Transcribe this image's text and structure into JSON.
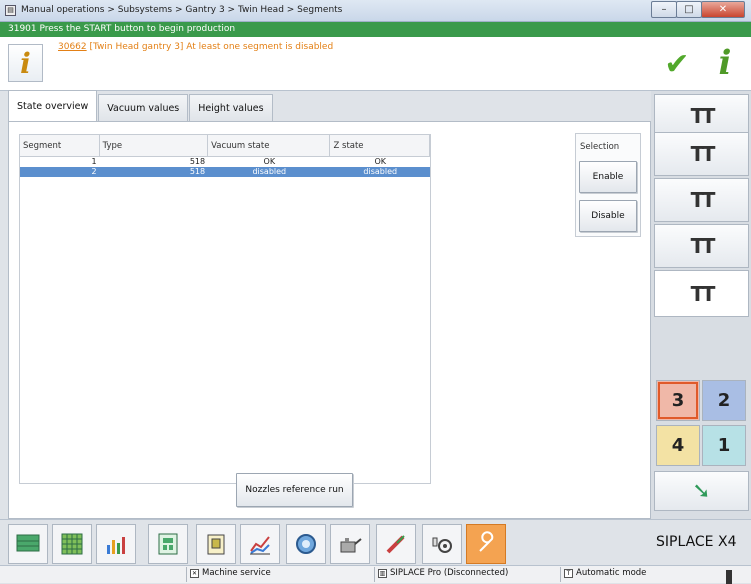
{
  "window": {
    "breadcrumb": "Manual operations > Subsystems > Gantry 3 > Twin Head > Segments",
    "minimize": "–",
    "maximize": "□",
    "close": "✕"
  },
  "status_banner": "31901 Press the START button to begin production",
  "message": {
    "code": "30662",
    "text": " [Twin Head gantry 3] At least one segment is disabled"
  },
  "icons": {
    "info": "i",
    "check": "✔",
    "nozzle_pair": "TT",
    "arrow": "➘"
  },
  "tabs": [
    {
      "label": "State overview",
      "active": true
    },
    {
      "label": "Vacuum values",
      "active": false
    },
    {
      "label": "Height values",
      "active": false
    }
  ],
  "table": {
    "columns": [
      "Segment",
      "Type",
      "Vacuum state",
      "Z state"
    ],
    "rows": [
      {
        "segment": "1",
        "type": "518",
        "vacuum": "OK",
        "z": "OK",
        "selected": false
      },
      {
        "segment": "2",
        "type": "518",
        "vacuum": "disabled",
        "z": "disabled",
        "selected": true
      }
    ]
  },
  "selection": {
    "label": "Selection",
    "enable": "Enable",
    "disable": "Disable"
  },
  "nozzle_button": "Nozzles reference run",
  "gantries": [
    "3",
    "2",
    "4",
    "1"
  ],
  "brand": "SIPLACE X4",
  "status": {
    "service": "Machine service",
    "pro": "SIPLACE Pro (Disconnected)",
    "mode": "Automatic mode"
  },
  "colors": {
    "banner_green": "#3a9a4b",
    "message_orange": "#e38016",
    "selected_row": "#5b8fce",
    "active_tool": "#f4a351"
  }
}
